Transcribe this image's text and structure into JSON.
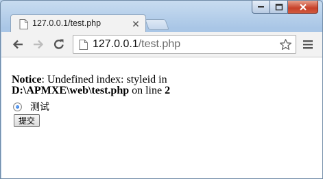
{
  "tab": {
    "title": "127.0.0.1/test.php"
  },
  "address_bar": {
    "host": "127.0.0.1",
    "path": "/test.php"
  },
  "notice": {
    "label": "Notice",
    "message": ": Undefined index: styleid in",
    "file": "D:\\APMXE\\web\\test.php",
    "line_prefix": " on line ",
    "line": "2"
  },
  "form": {
    "radio_label": "测试",
    "radio_checked": true,
    "submit_label": "提交"
  },
  "icons": {
    "back": "back-arrow-icon",
    "forward": "forward-arrow-icon",
    "reload": "reload-icon",
    "page": "page-icon",
    "star": "star-icon",
    "menu": "hamburger-menu-icon",
    "tab_close": "close-icon"
  }
}
